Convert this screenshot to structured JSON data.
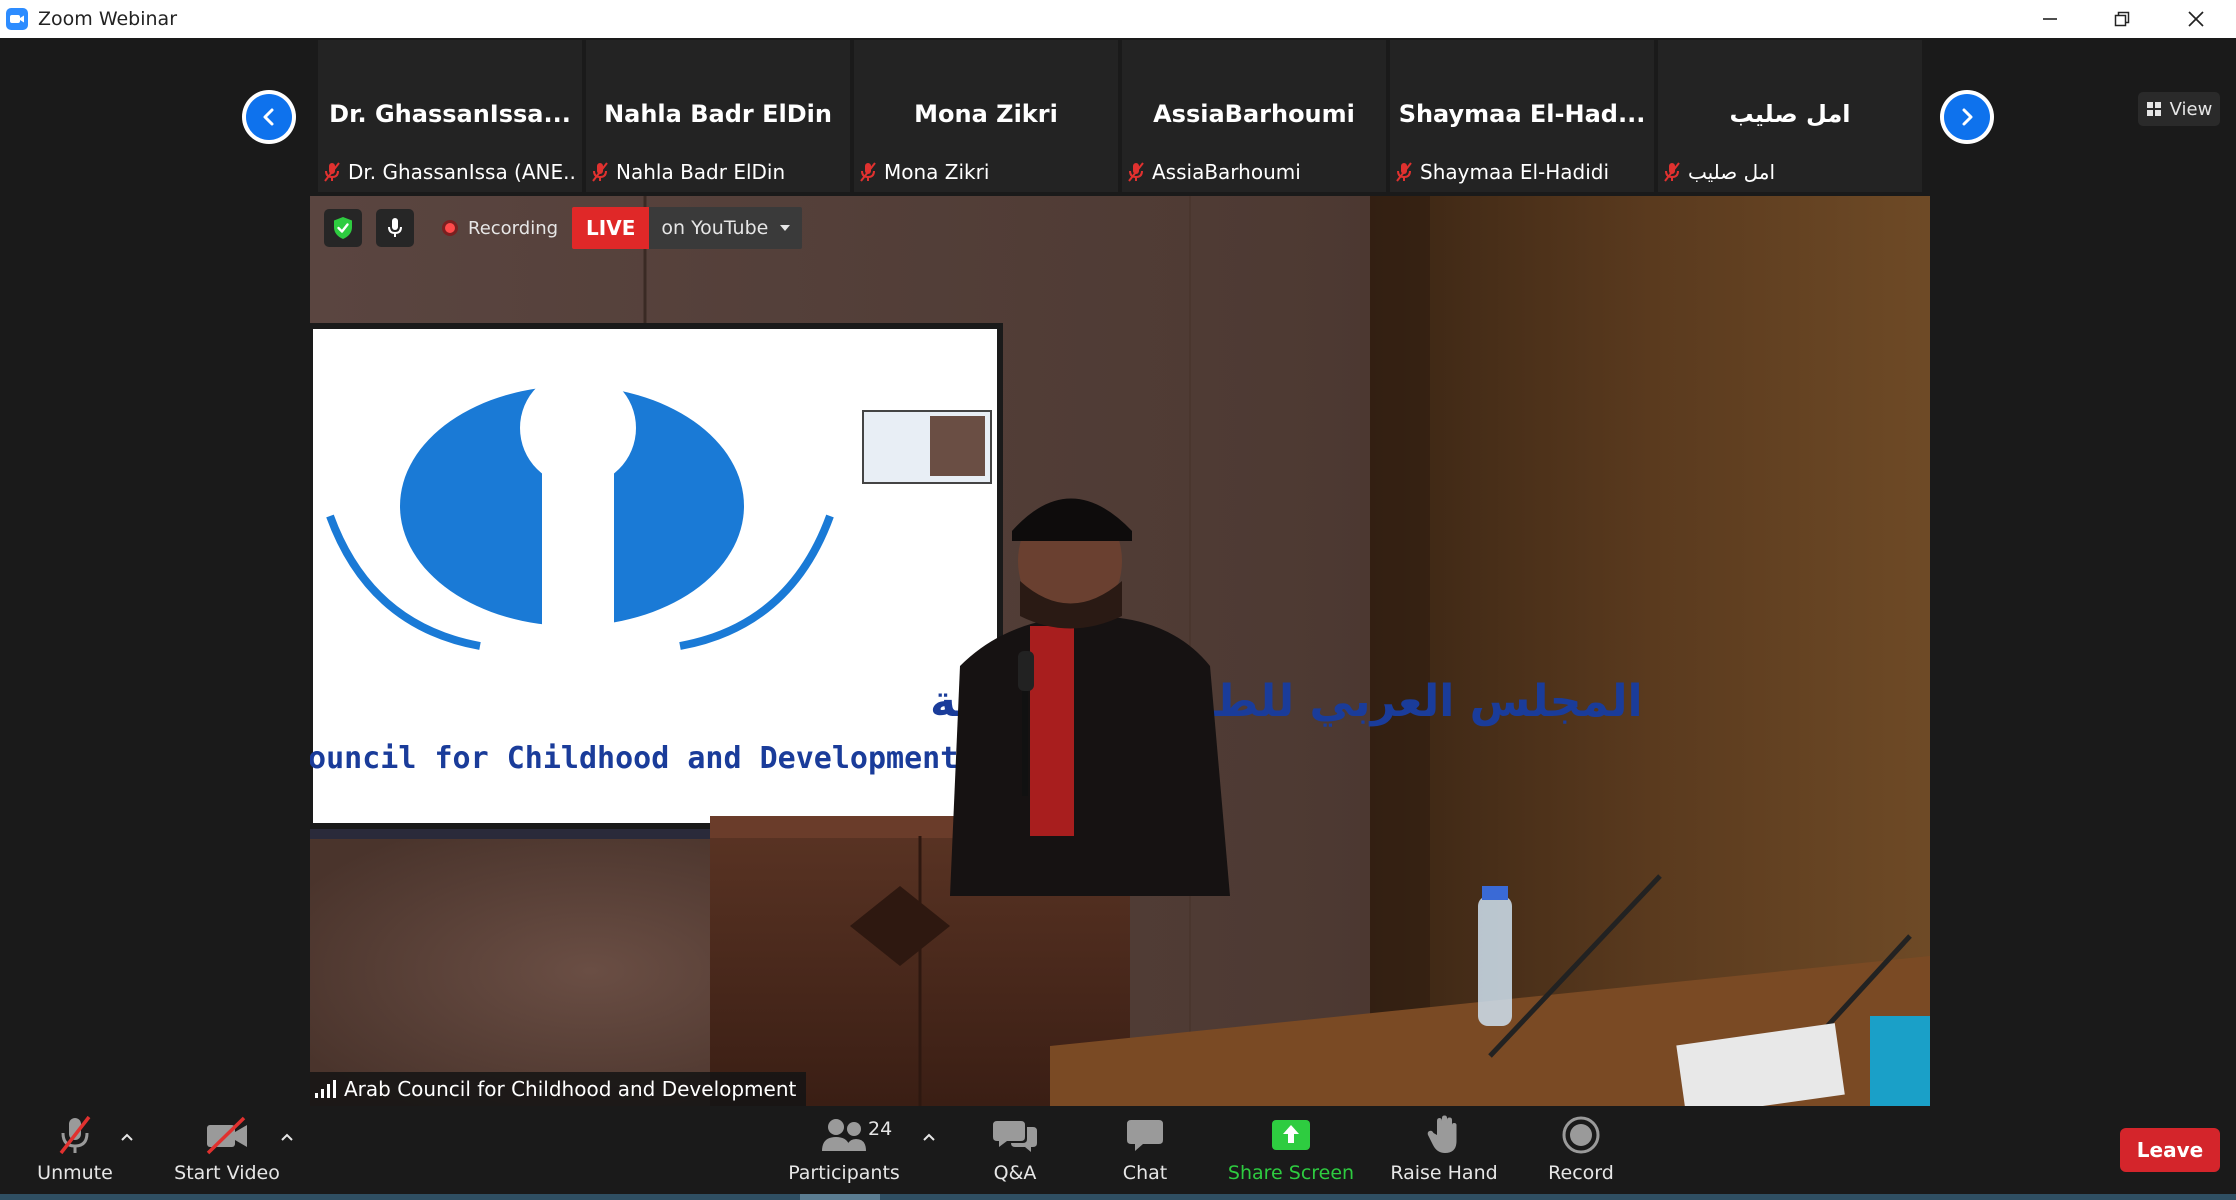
{
  "window": {
    "title": "Zoom Webinar"
  },
  "strip": {
    "view_label": "View",
    "participants": [
      {
        "name": "Dr. GhassanIssa...",
        "label": "Dr. GhassanIssa (ANE..."
      },
      {
        "name": "Nahla Badr ElDin",
        "label": "Nahla Badr ElDin"
      },
      {
        "name": "Mona Zikri",
        "label": "Mona Zikri"
      },
      {
        "name": "AssiaBarhoumi",
        "label": "AssiaBarhoumi"
      },
      {
        "name": "Shaymaa  El-Had...",
        "label": "Shaymaa El-Hadidi"
      },
      {
        "name": "امل صليب",
        "label": "امل صليب"
      }
    ]
  },
  "video": {
    "recording_label": "Recording",
    "live_label": "LIVE",
    "stream_target": "on YouTube",
    "speaker_name": "Arab Council for Childhood and Development",
    "slide": {
      "arabic_text": "المجلس العربي للطفولة والتنمية",
      "english_text": "Council for Childhood and Development"
    }
  },
  "toolbar": {
    "unmute": "Unmute",
    "start_video": "Start Video",
    "participants": "Participants",
    "participants_count": "24",
    "qa": "Q&A",
    "chat": "Chat",
    "share_screen": "Share Screen",
    "raise_hand": "Raise Hand",
    "record": "Record",
    "leave": "Leave"
  },
  "colors": {
    "accent_blue": "#0e72ed",
    "live_red": "#e02828",
    "leave_red": "#d4252b",
    "share_green": "#2ecc40",
    "muted_red": "#e0312f"
  }
}
